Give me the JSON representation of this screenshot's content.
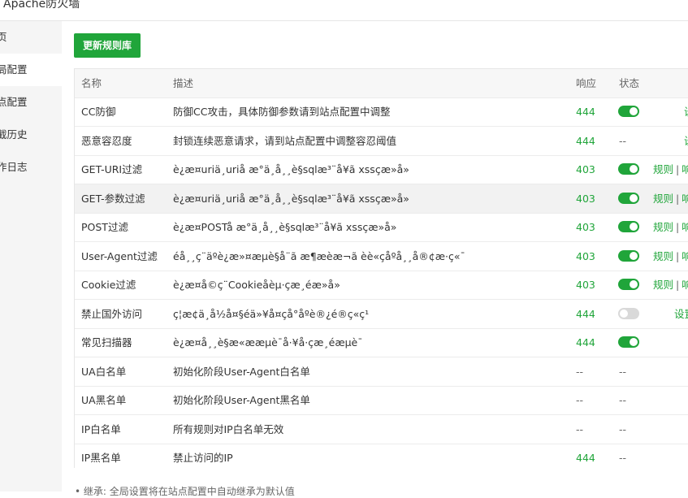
{
  "window": {
    "title": "Apache防火墙"
  },
  "sidebar": {
    "items": [
      {
        "label": "页",
        "active": false
      },
      {
        "label": "局配置",
        "active": true
      },
      {
        "label": "点配置",
        "active": false
      },
      {
        "label": "截历史",
        "active": false
      },
      {
        "label": "作日志",
        "active": false
      }
    ]
  },
  "toolbar": {
    "update_label": "更新规则库"
  },
  "table": {
    "headers": {
      "name": "名称",
      "desc": "描述",
      "code": "响应",
      "status": "状态"
    },
    "rows": [
      {
        "name": "CC防御",
        "desc": "防御CC攻击，具体防御参数请到站点配置中调整",
        "code": "444",
        "status": "on",
        "status_text": "",
        "action": "设"
      },
      {
        "name": "恶意容忍度",
        "desc": "封锁连续恶意请求，请到站点配置中调整容忍阈值",
        "code": "444",
        "status": "text",
        "status_text": "--",
        "action": "设"
      },
      {
        "name": "GET-URI过滤",
        "desc": "è¿æ¤uriä¸­uriå æ°ä¸­å¸¸è§sqlæ³¨å¥ã xssçæ»å»",
        "code": "403",
        "status": "on",
        "status_text": "",
        "action": "规则 | 响"
      },
      {
        "name": "GET-参数过滤",
        "desc": "è¿æ¤uriä¸­uriå æ°ä¸­å¸¸è§sqlæ³¨å¥ã xssçæ»å»",
        "code": "403",
        "status": "on",
        "status_text": "",
        "action": "规则 | 响"
      },
      {
        "name": "POST过滤",
        "desc": "è¿æ¤POSTå æ°ä¸­å¸¸è§sqlæ³¨å¥ã xssçæ»å»",
        "code": "403",
        "status": "on",
        "status_text": "",
        "action": "规则 | 响"
      },
      {
        "name": "User-Agent过滤",
        "desc": "éå¸¸ç¨äºè¿æ»¤æµè§å¨ã æ¶æèæ¬ã èè«ç­åºå¸¸å®¢æ·ç«¯",
        "code": "403",
        "status": "on",
        "status_text": "",
        "action": "规则 | 响"
      },
      {
        "name": "Cookie过滤",
        "desc": "è¿æ¤å©ç¨Cookieåèµ·çæ¸éæ»å»",
        "code": "403",
        "status": "on",
        "status_text": "",
        "action": "规则 | 响"
      },
      {
        "name": "禁止国外访问",
        "desc": "ç¦æ­¢ä¸­å½å¤§éä»¥å¤çå°åºè®¿é®ç«ç¹",
        "code": "444",
        "status": "off",
        "status_text": "",
        "action": "设置"
      },
      {
        "name": "常见扫描器",
        "desc": "è¿æ¤å¸¸è§æ«ææµè¯å·¥å·çæ¸éæµè¯",
        "code": "444",
        "status": "on",
        "status_text": "",
        "action": ""
      },
      {
        "name": "UA白名单",
        "desc": "初始化阶段User-Agent白名单",
        "code": "--",
        "status": "text",
        "status_text": "--",
        "action": ""
      },
      {
        "name": "UA黑名单",
        "desc": "初始化阶段User-Agent黑名单",
        "code": "--",
        "status": "text",
        "status_text": "--",
        "action": ""
      },
      {
        "name": "IP白名单",
        "desc": "所有规则对IP白名单无效",
        "code": "--",
        "status": "text",
        "status_text": "--",
        "action": ""
      },
      {
        "name": "IP黑名单",
        "desc": "禁止访问的IP",
        "code": "444",
        "status": "text",
        "status_text": "--",
        "action": ""
      }
    ]
  },
  "tip": "• 继承: 全局设置将在站点配置中自动继承为默认值",
  "colors": {
    "accent": "#20a53a",
    "toggle_off": "#d9d9d9"
  }
}
